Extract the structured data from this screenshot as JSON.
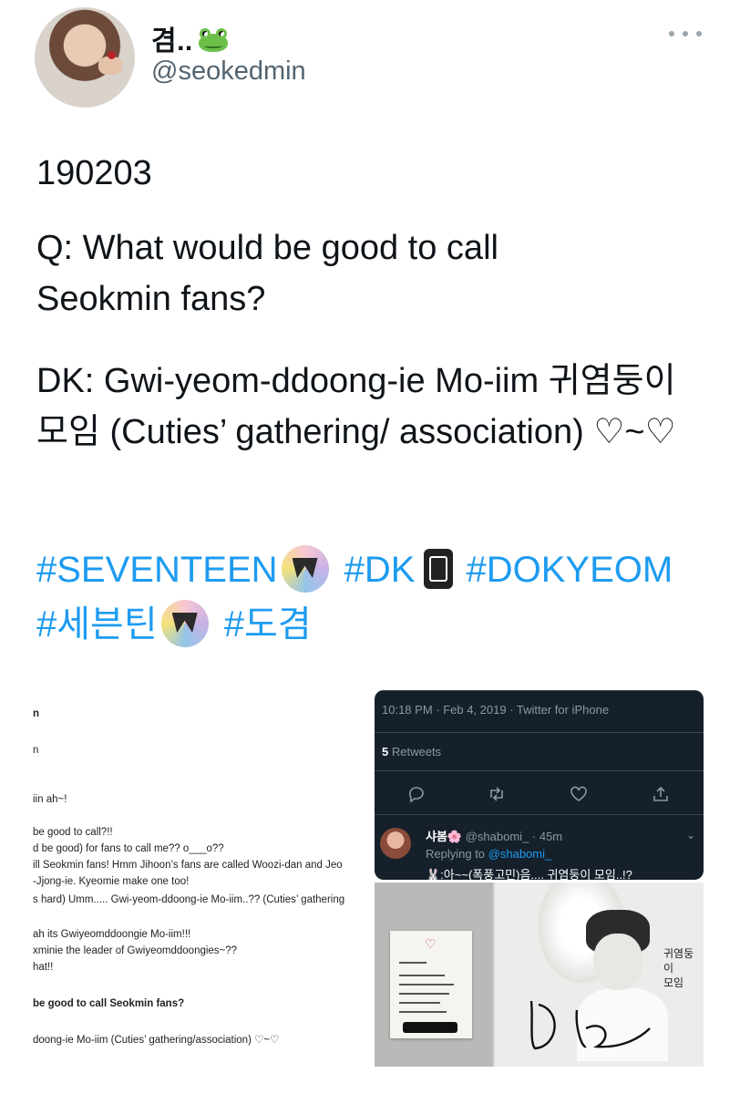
{
  "tweet": {
    "display_name": "겸..",
    "handle": "@seokedmin",
    "date": "190203",
    "question": "Q: What would be good to call Seokmin fans?",
    "answer": "DK: Gwi-yeom-ddoong-ie Mo-iim 귀염둥이 모임 (Cuties’ gathering/ association) ♡~♡",
    "hashtags": [
      "#SEVENTEEN",
      "#DK",
      "#DOKYEOM",
      "#세븐틴",
      "#도겸"
    ]
  },
  "icons": {
    "frog": "frog-emoji-icon",
    "more": "more-options-icon",
    "seventeen": "seventeen-logo-icon",
    "dk": "dk-badge-icon"
  },
  "colors": {
    "hashtag": "#1d9bf0",
    "handle": "#536471",
    "dark_bg": "#15202b"
  },
  "screenshot_article": {
    "lines": [
      "n",
      "n",
      "iin ah~!",
      " be good to call?!!",
      "d be good) for fans to call me?? o___o??",
      "ill Seokmin fans! Hmm Jihoon’s fans are called Woozi-dan and Jeo",
      "-Jjong-ie. Kyeomie make one too!",
      "s hard) Umm..... Gwi-yeom-ddoong-ie Mo-iim..?? (Cuties’ gathering",
      "ah its Gwiyeomddoongie Mo-iim!!!",
      "xminie the leader of Gwiyeomddoongies~??",
      "hat!!",
      "be good to call Seokmin fans?",
      "doong-ie Mo-iim (Cuties’ gathering/association) ♡~♡"
    ]
  },
  "screenshot_twitter": {
    "meta": "10:18 PM · Feb 4, 2019 · Twitter for iPhone",
    "retweets_count": "5",
    "retweets_label": "Retweets",
    "reply_name": "샤봄🌸",
    "reply_handle": "@shabomi_ · 45m",
    "replying_prefix": "Replying to",
    "replying_handle": "@shabomi_",
    "reply_text": "🐰:아~~(폭풍고민)음.... 귀염둥이 모임..!?"
  },
  "photo": {
    "handwriting": [
      "귀염둥이",
      "모임"
    ]
  }
}
